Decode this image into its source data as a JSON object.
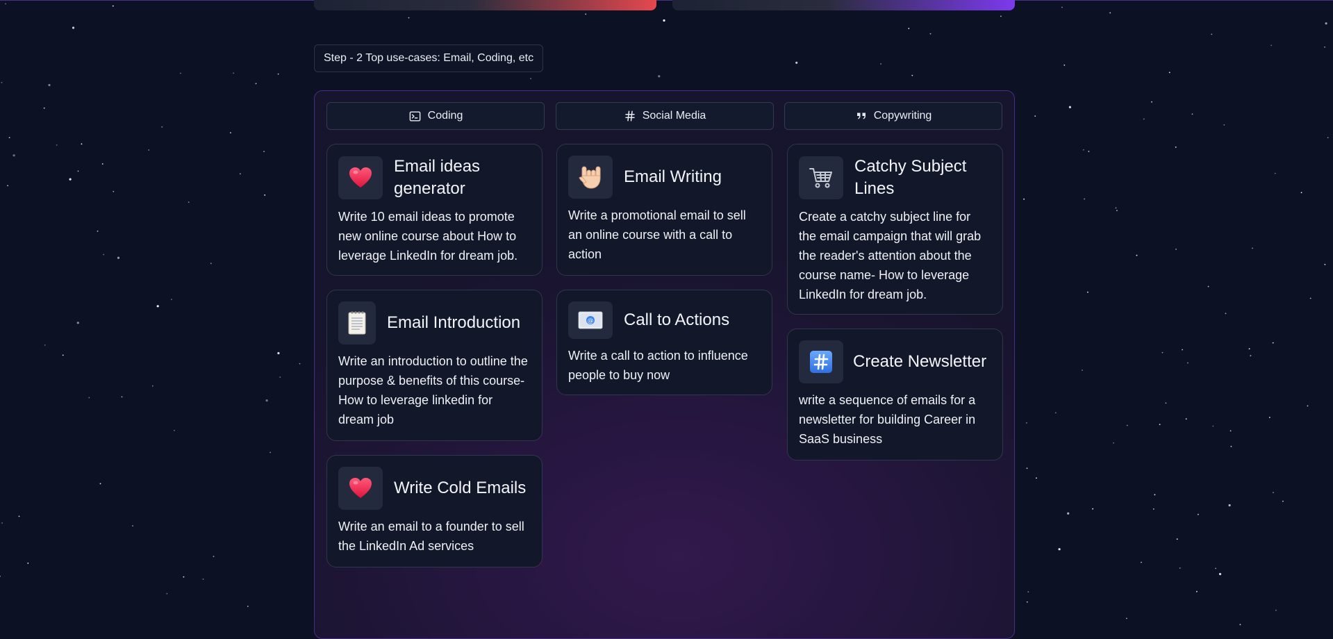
{
  "step_label": "Step - 2 Top use-cases: Email, Coding, etc",
  "tabs": [
    {
      "label": "Coding",
      "icon": "terminal-icon"
    },
    {
      "label": "Social Media",
      "icon": "hash-icon"
    },
    {
      "label": "Copywriting",
      "icon": "quote-icon"
    }
  ],
  "cards": [
    {
      "title": "Email ideas generator",
      "description": "Write 10 email ideas to promote new online course about How to leverage LinkedIn for dream job.",
      "icon": "heart-icon"
    },
    {
      "title": "Email Introduction",
      "description": "Write an introduction to outline the purpose & benefits of this course- How to leverage linkedin for dream job",
      "icon": "notepad-icon"
    },
    {
      "title": "Write Cold Emails",
      "description": "Write an email to a founder to sell the LinkedIn Ad services",
      "icon": "heart-icon"
    },
    {
      "title": "Email Writing",
      "description": "Write a promotional email to sell an online course with a call to action",
      "icon": "love-you-hand-icon"
    },
    {
      "title": "Call to Actions",
      "description": "Write a call to action to influence people to buy now",
      "icon": "email-envelope-icon"
    },
    {
      "title": "Catchy Subject Lines",
      "description": "Create a catchy subject line for the email campaign that will grab the reader's attention about the course name- How to leverage LinkedIn for dream job.",
      "icon": "shopping-cart-icon"
    },
    {
      "title": "Create Newsletter",
      "description": "write a sequence of emails for a newsletter for building Career in SaaS business",
      "icon": "keycap-hash-icon"
    }
  ],
  "colors": {
    "background": "#0d1124",
    "panel_border": "#4a2c8a",
    "card_bg": "#121829",
    "accent_red": "#e5484d",
    "accent_purple": "#7c3aed"
  }
}
